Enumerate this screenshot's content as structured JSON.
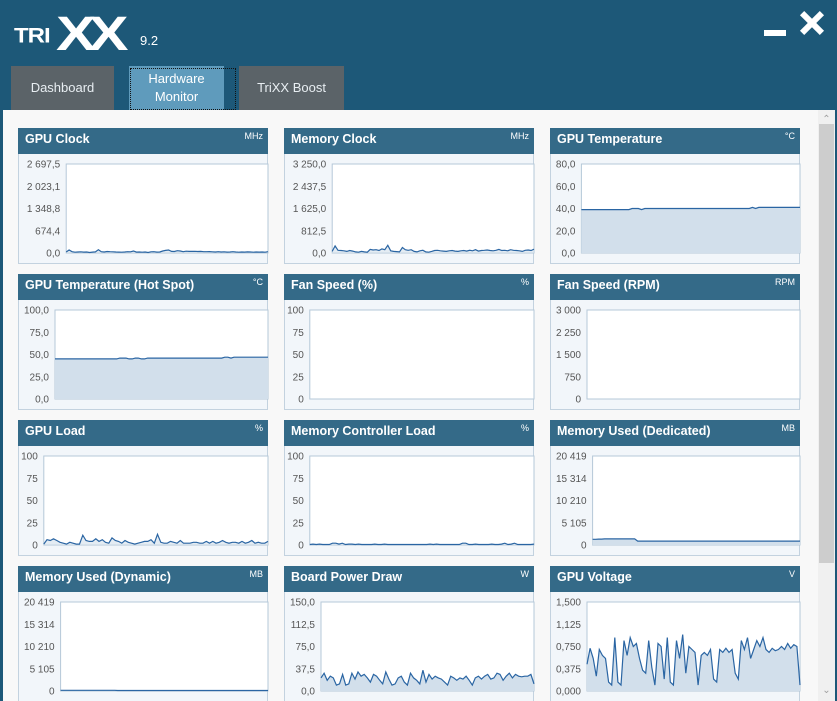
{
  "app": {
    "logo_prefix": "TRI",
    "logo_mark": "XX",
    "version": "9.2",
    "minimize_icon": "minimize-icon",
    "close_icon": "close-icon"
  },
  "tabs": [
    {
      "label": "Dashboard",
      "active": false
    },
    {
      "label": "Hardware Monitor",
      "active": true
    },
    {
      "label": "TriXX Boost",
      "active": false
    }
  ],
  "scrollbar": {
    "up_glyph": "^",
    "down_glyph": "v",
    "position_fraction": 0.0,
    "visible_fraction": 0.74
  },
  "colors": {
    "titlebar": "#1d5878",
    "panel_header": "#346a88",
    "line": "#2a65a3",
    "fill": "#d2dfeb",
    "active_tab": "#5f9bbc",
    "inactive_tab": "#5b6368"
  },
  "chart_data": [
    {
      "type": "area",
      "title": "GPU Clock",
      "unit": "MHz",
      "ylim": [
        0,
        2697.5
      ],
      "yticks": [
        "2 697,5",
        "2 023,1",
        "1 348,8",
        "674,4",
        "0,0"
      ],
      "fill": false,
      "values": [
        30,
        90,
        40,
        25,
        30,
        35,
        28,
        30,
        15,
        28,
        32,
        100,
        40,
        30,
        45,
        38,
        35,
        30,
        28,
        25,
        30,
        40,
        35,
        60,
        28,
        30,
        25,
        30,
        15,
        35,
        40,
        28,
        30,
        60,
        80,
        90,
        50,
        45,
        70,
        60,
        40,
        55,
        50,
        48,
        52,
        45,
        50,
        40,
        38,
        42,
        35,
        30,
        40,
        30,
        35,
        28,
        30,
        38,
        30,
        25,
        30,
        28,
        32,
        30,
        25,
        30,
        28,
        30,
        25,
        40
      ]
    },
    {
      "type": "area",
      "title": "Memory Clock",
      "unit": "MHz",
      "ylim": [
        0,
        3250
      ],
      "yticks": [
        "3 250,0",
        "2 437,5",
        "1 625,0",
        "812,5",
        "0,0"
      ],
      "fill": false,
      "values": [
        60,
        260,
        100,
        90,
        80,
        60,
        90,
        70,
        40,
        30,
        60,
        40,
        30,
        130,
        110,
        120,
        90,
        150,
        120,
        280,
        80,
        60,
        50,
        40,
        200,
        120,
        100,
        120,
        60,
        40,
        80,
        100,
        40,
        30,
        60,
        90,
        100,
        80,
        70,
        60,
        80,
        90,
        70,
        60,
        80,
        90,
        70,
        100,
        80,
        120,
        70,
        90,
        100,
        110,
        90,
        80,
        100,
        130,
        90,
        100,
        80,
        120,
        100,
        90,
        80,
        60,
        100,
        110,
        90,
        140
      ]
    },
    {
      "type": "area",
      "title": "GPU Temperature",
      "unit": "°C",
      "ylim": [
        0,
        80
      ],
      "yticks": [
        "80,0",
        "60,0",
        "40,0",
        "20,0",
        "0,0"
      ],
      "fill": true,
      "values": [
        39,
        39,
        39,
        39,
        39,
        39,
        39,
        39,
        39,
        39,
        39,
        39,
        39,
        39,
        39,
        39,
        40,
        40,
        40,
        39,
        40,
        40,
        40,
        40,
        40,
        40,
        40,
        40,
        40,
        40,
        40,
        40,
        40,
        40,
        40,
        40,
        40,
        40,
        40,
        40,
        40,
        40,
        40,
        40,
        40,
        40,
        40,
        40,
        40,
        40,
        40,
        40,
        40,
        40,
        41,
        40,
        41,
        41,
        41,
        41,
        41,
        41,
        41,
        41,
        41,
        41,
        41,
        41,
        41,
        41
      ]
    },
    {
      "type": "area",
      "title": "GPU Temperature (Hot Spot)",
      "unit": "°C",
      "ylim": [
        0,
        100
      ],
      "yticks": [
        "100,0",
        "75,0",
        "50,0",
        "25,0",
        "0,0"
      ],
      "fill": true,
      "values": [
        45,
        45,
        45,
        45,
        45,
        45,
        45,
        45,
        45,
        45,
        45,
        45,
        45,
        45,
        45,
        45,
        45,
        45,
        45,
        45,
        45,
        46,
        46,
        46,
        45,
        45,
        46,
        46,
        45,
        45,
        46,
        46,
        46,
        46,
        46,
        46,
        46,
        46,
        46,
        46,
        46,
        46,
        46,
        46,
        46,
        46,
        46,
        46,
        46,
        46,
        46,
        46,
        46,
        46,
        46,
        47,
        47,
        46,
        47,
        47,
        47,
        47,
        47,
        47,
        47,
        47,
        47,
        47,
        47,
        47
      ]
    },
    {
      "type": "area",
      "title": "Fan Speed (%)",
      "unit": "%",
      "ylim": [
        0,
        100
      ],
      "yticks": [
        "100",
        "75",
        "50",
        "25",
        "0"
      ],
      "fill": false,
      "values": []
    },
    {
      "type": "area",
      "title": "Fan Speed (RPM)",
      "unit": "RPM",
      "ylim": [
        0,
        3000
      ],
      "yticks": [
        "3 000",
        "2 250",
        "1 500",
        "750",
        "0"
      ],
      "fill": false,
      "values": []
    },
    {
      "type": "area",
      "title": "GPU Load",
      "unit": "%",
      "ylim": [
        0,
        100
      ],
      "yticks": [
        "100",
        "75",
        "50",
        "25",
        "0"
      ],
      "fill": false,
      "values": [
        1,
        6,
        5,
        7,
        5,
        3,
        2,
        1,
        3,
        2,
        1,
        1,
        11,
        5,
        4,
        4,
        7,
        4,
        6,
        3,
        2,
        8,
        5,
        4,
        2,
        5,
        3,
        2,
        1,
        2,
        3,
        4,
        4,
        6,
        2,
        12,
        3,
        2,
        2,
        4,
        3,
        2,
        5,
        2,
        2,
        2,
        3,
        3,
        2,
        2,
        4,
        2,
        4,
        2,
        3,
        5,
        3,
        2,
        3,
        3,
        2,
        4,
        2,
        3,
        5,
        2,
        3,
        2,
        2,
        4
      ]
    },
    {
      "type": "area",
      "title": "Memory Controller Load",
      "unit": "%",
      "ylim": [
        0,
        100
      ],
      "yticks": [
        "100",
        "75",
        "50",
        "25",
        "0"
      ],
      "fill": false,
      "values": [
        0,
        1,
        0,
        1,
        0,
        0,
        0,
        2,
        2,
        1,
        2,
        0,
        1,
        1,
        0,
        1,
        0,
        0,
        0,
        0,
        1,
        0,
        0,
        1,
        0,
        0,
        0,
        0,
        0,
        0,
        0,
        0,
        0,
        0,
        0,
        0,
        0,
        1,
        0,
        1,
        0,
        0,
        0,
        0,
        0,
        0,
        0,
        2,
        2,
        0,
        0,
        1,
        0,
        0,
        0,
        0,
        1,
        0,
        0,
        1,
        2,
        0,
        1,
        2,
        0,
        0,
        0,
        0,
        0,
        1
      ]
    },
    {
      "type": "area",
      "title": "Memory Used (Dedicated)",
      "unit": "MB",
      "ylim": [
        0,
        20419
      ],
      "yticks": [
        "20 419",
        "15 314",
        "10 210",
        "5 105",
        "0"
      ],
      "fill": true,
      "values": [
        1300,
        1300,
        1350,
        1350,
        1400,
        1400,
        1400,
        1400,
        1400,
        1400,
        1400,
        1400,
        1400,
        1400,
        1400,
        900,
        900,
        900,
        900,
        900,
        900,
        900,
        900,
        900,
        900,
        900,
        900,
        900,
        900,
        900,
        900,
        900,
        900,
        900,
        900,
        900,
        900,
        900,
        900,
        900,
        900,
        900,
        900,
        900,
        900,
        900,
        900,
        900,
        900,
        900,
        900,
        900,
        900,
        900,
        900,
        900,
        900,
        900,
        900,
        900,
        900,
        900,
        900,
        900,
        900,
        900,
        900,
        900,
        900,
        900
      ]
    },
    {
      "type": "area",
      "title": "Memory Used (Dynamic)",
      "unit": "MB",
      "ylim": [
        0,
        20419
      ],
      "yticks": [
        "20 419",
        "15 314",
        "10 210",
        "5 105",
        "0"
      ],
      "fill": false,
      "values": [
        150,
        150,
        150,
        150,
        150,
        150,
        150,
        150,
        150,
        150,
        150,
        150,
        150,
        150,
        150,
        150,
        150,
        150,
        150,
        0,
        0,
        0,
        0,
        0,
        0,
        0,
        0,
        0,
        0,
        0,
        0,
        0,
        0,
        0,
        0,
        0,
        0,
        0,
        0,
        0,
        0,
        0,
        0,
        0,
        0,
        0,
        0,
        0,
        0,
        0,
        0,
        0,
        0,
        0,
        0,
        0,
        0,
        0,
        0,
        0,
        0,
        0,
        0,
        0,
        0,
        0,
        0,
        0,
        0,
        0
      ]
    },
    {
      "type": "area",
      "title": "Board Power Draw",
      "unit": "W",
      "ylim": [
        0,
        150
      ],
      "yticks": [
        "150,0",
        "112,5",
        "75,0",
        "37,5",
        "0,0"
      ],
      "fill": true,
      "values": [
        22,
        30,
        18,
        25,
        22,
        10,
        12,
        28,
        10,
        12,
        30,
        20,
        32,
        25,
        28,
        22,
        15,
        28,
        25,
        18,
        12,
        32,
        20,
        10,
        12,
        22,
        25,
        15,
        10,
        30,
        22,
        18,
        12,
        35,
        15,
        28,
        20,
        25,
        22,
        20,
        15,
        10,
        25,
        22,
        18,
        22,
        20,
        25,
        18,
        10,
        22,
        25,
        20,
        25,
        28,
        20,
        22,
        30,
        28,
        18,
        25,
        30,
        22,
        28,
        25,
        24,
        25,
        25,
        28,
        12
      ]
    },
    {
      "type": "area",
      "title": "GPU Voltage",
      "unit": "V",
      "ylim": [
        0,
        1.5
      ],
      "yticks": [
        "1,500",
        "1,125",
        "0,750",
        "0,375",
        "0,000"
      ],
      "fill": true,
      "values": [
        0.45,
        0.72,
        0.55,
        0.25,
        0.7,
        0.6,
        0.55,
        0.15,
        0.1,
        0.9,
        0.15,
        0.1,
        0.85,
        0.6,
        0.9,
        0.75,
        0.8,
        0.55,
        0.35,
        0.3,
        0.85,
        0.4,
        0.1,
        0.8,
        0.75,
        0.2,
        0.9,
        0.15,
        0.1,
        0.85,
        0.55,
        0.95,
        0.3,
        0.75,
        0.7,
        0.65,
        0.1,
        0.6,
        0.65,
        0.6,
        0.7,
        0.2,
        0.15,
        0.7,
        0.65,
        0.72,
        0.65,
        0.7,
        0.3,
        0.2,
        0.85,
        0.7,
        0.9,
        0.55,
        0.7,
        0.85,
        0.75,
        0.9,
        0.7,
        0.65,
        0.72,
        0.68,
        0.7,
        0.75,
        0.7,
        0.8,
        0.72,
        0.78,
        0.75,
        0.1
      ]
    }
  ]
}
